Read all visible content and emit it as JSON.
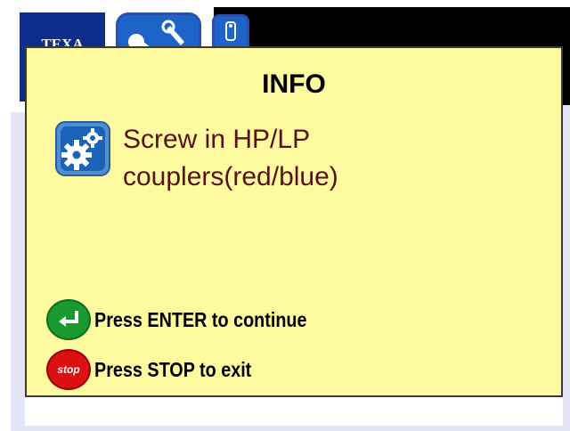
{
  "header": {
    "logo_text": "TEXA"
  },
  "dialog": {
    "title": "INFO",
    "message_line1": "Screw in HP/LP",
    "message_line2": "couplers(red/blue)",
    "enter_label": "Press ENTER to continue",
    "stop_label": "Press STOP to exit",
    "stop_icon_text": "stop"
  },
  "icons": {
    "main_tool": "tools-icon",
    "small_tab": "device-icon",
    "message": "gears-icon",
    "enter": "enter-icon",
    "stop": "stop-icon"
  },
  "colors": {
    "dialog_bg": "#fdfaa0",
    "header_black": "#000000",
    "brand_blue": "#0e2d8c",
    "button_blue": "#1e63c8",
    "message_text": "#5a1010",
    "enter_green": "#1a9a2e",
    "stop_red": "#dc1010",
    "lavender_bg": "#e4e6f7"
  }
}
